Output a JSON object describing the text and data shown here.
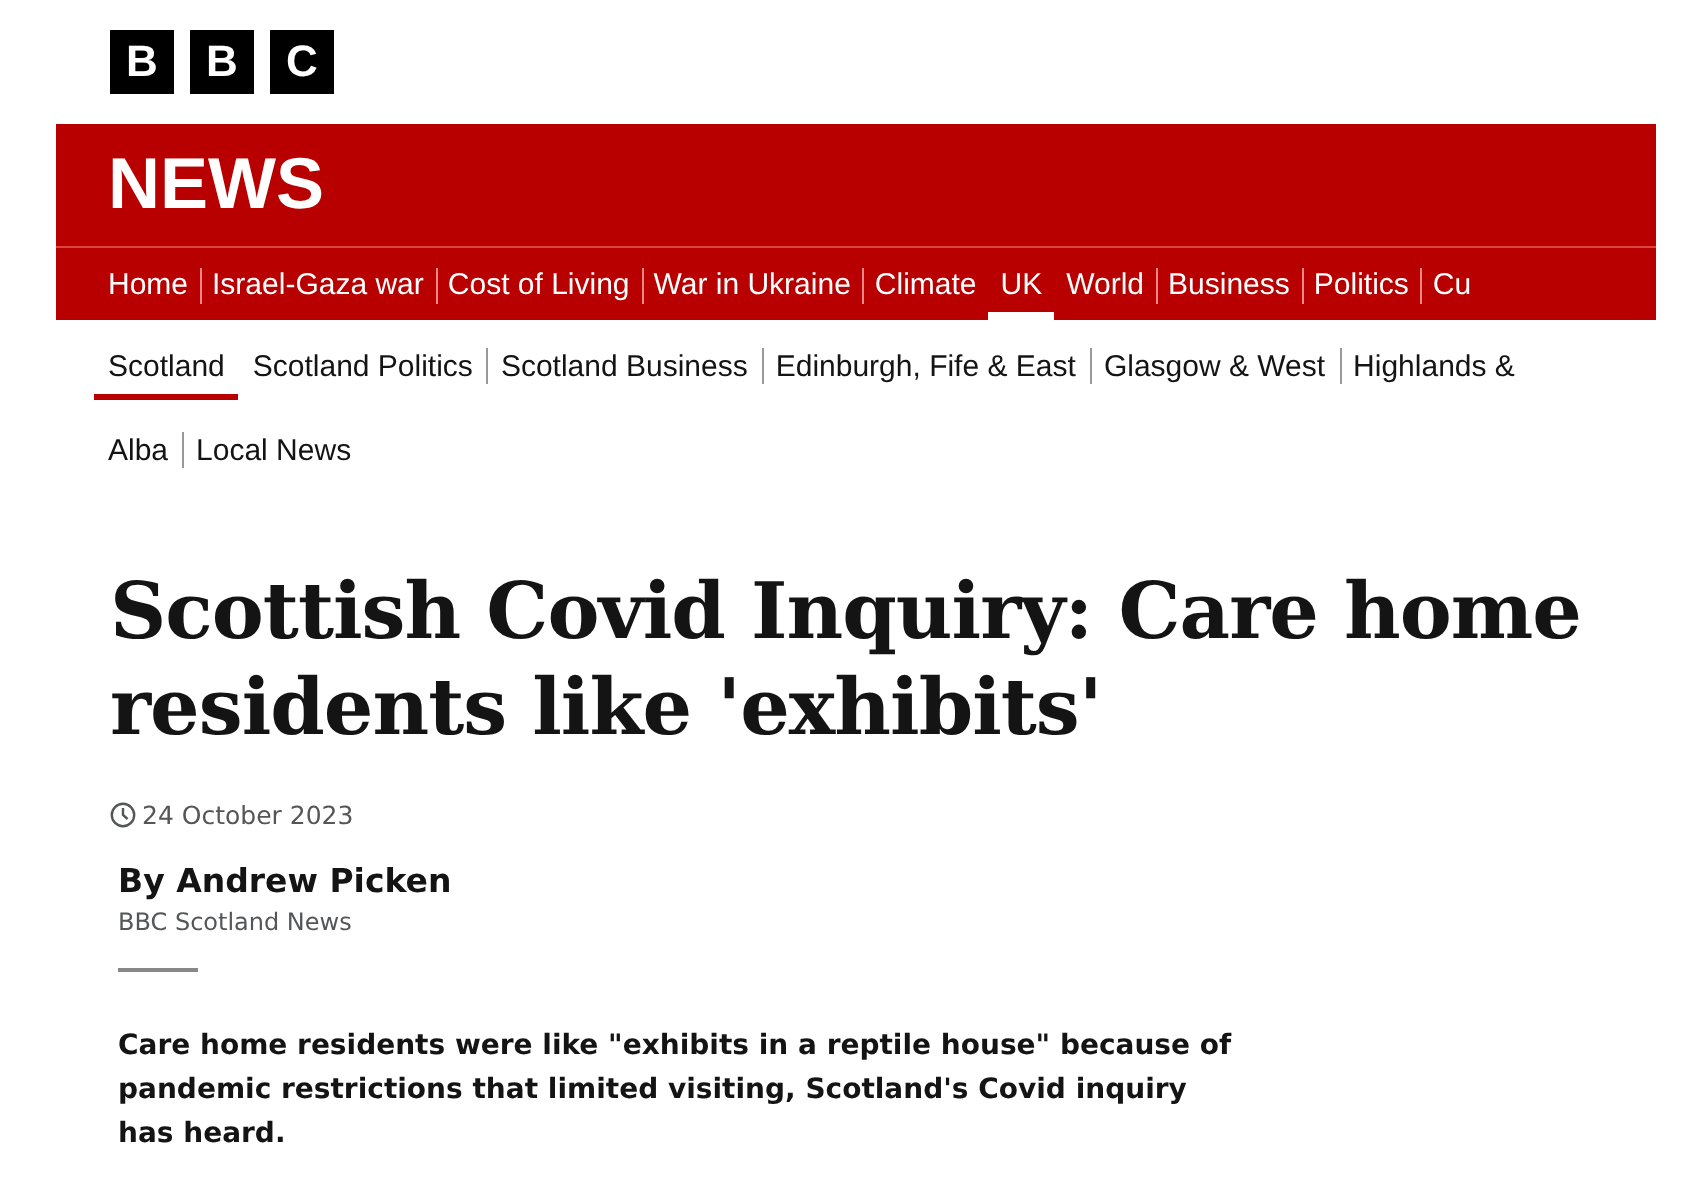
{
  "logo": {
    "letters": [
      "B",
      "B",
      "C"
    ]
  },
  "banner": {
    "title": "NEWS"
  },
  "nav": [
    {
      "label": "Home",
      "selected": false
    },
    {
      "label": "Israel-Gaza war",
      "selected": false
    },
    {
      "label": "Cost of Living",
      "selected": false
    },
    {
      "label": "War in Ukraine",
      "selected": false
    },
    {
      "label": "Climate",
      "selected": false
    },
    {
      "label": "UK",
      "selected": true
    },
    {
      "label": "World",
      "selected": false
    },
    {
      "label": "Business",
      "selected": false
    },
    {
      "label": "Politics",
      "selected": false
    },
    {
      "label": "Cu",
      "selected": false
    }
  ],
  "subnav": [
    [
      {
        "label": "Scotland",
        "selected": true
      },
      {
        "label": "Scotland Politics",
        "selected": false
      },
      {
        "label": "Scotland Business",
        "selected": false
      },
      {
        "label": "Edinburgh, Fife & East",
        "selected": false
      },
      {
        "label": "Glasgow & West",
        "selected": false
      },
      {
        "label": "Highlands &",
        "selected": false
      }
    ],
    [
      {
        "label": "Alba",
        "selected": false
      },
      {
        "label": "Local News",
        "selected": false
      }
    ]
  ],
  "article": {
    "headline": "Scottish Covid Inquiry: Care home residents like 'exhibits'",
    "date": "24 October 2023",
    "author": "By Andrew Picken",
    "author_org": "BBC Scotland News",
    "summary": "Care home residents were like \"exhibits in a reptile house\" because of pandemic restrictions that limited visiting, Scotland's Covid inquiry has heard."
  }
}
